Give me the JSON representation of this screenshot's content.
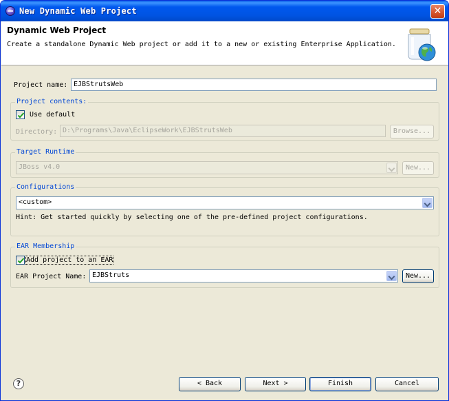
{
  "window": {
    "title": "New Dynamic Web Project",
    "close_glyph": "✕"
  },
  "header": {
    "title": "Dynamic Web Project",
    "description": "Create a standalone Dynamic Web project or add it to a new or existing Enterprise Application.",
    "graphic_icon": "jar-globe-icon"
  },
  "project_name": {
    "label": "Project name:",
    "value": "EJBStrutsWeb"
  },
  "project_contents": {
    "title": "Project contents:",
    "use_default_label": "Use default",
    "use_default_checked": true,
    "directory_label": "Directory:",
    "directory_value": "D:\\Programs\\Java\\EclipseWork\\EJBStrutsWeb",
    "browse_label": "Browse..."
  },
  "target_runtime": {
    "title": "Target Runtime",
    "value": "JBoss v4.0",
    "new_label": "New..."
  },
  "configurations": {
    "title": "Configurations",
    "value": "<custom>",
    "hint": "Hint: Get started quickly by selecting one of the pre-defined project configurations."
  },
  "ear_membership": {
    "title": "EAR Membership",
    "add_label": "Add project to an EAR",
    "add_checked": true,
    "ear_name_label": "EAR Project Name:",
    "ear_name_value": "EJBStruts",
    "new_label": "New..."
  },
  "footer": {
    "help_glyph": "?",
    "back_label": "< Back",
    "next_label": "Next >",
    "finish_label": "Finish",
    "cancel_label": "Cancel"
  },
  "colors": {
    "titlebar": "#0054e3",
    "group_title": "#0046d5",
    "dialog_bg": "#ece9d8"
  }
}
